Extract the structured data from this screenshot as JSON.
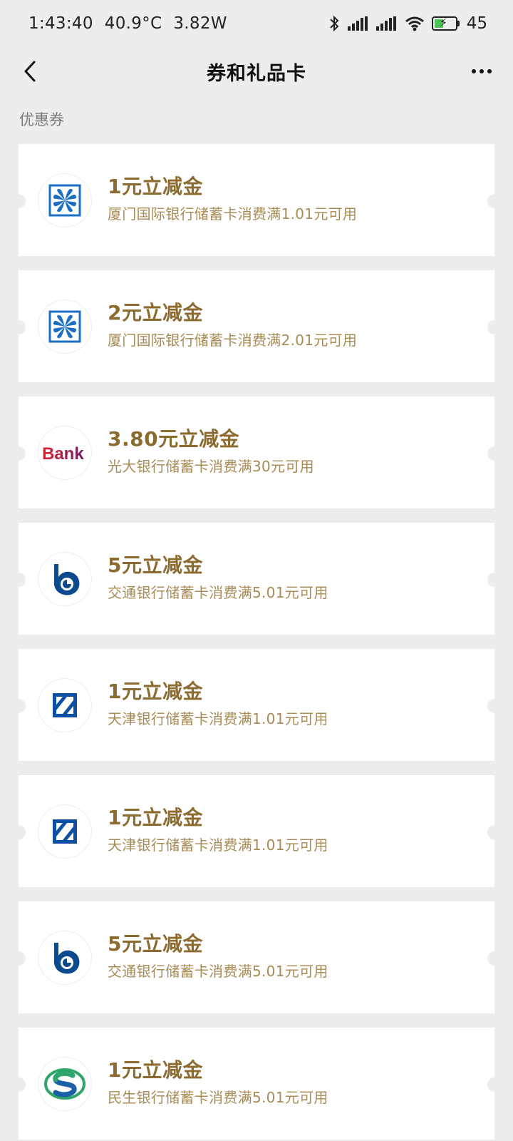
{
  "status_bar": {
    "time": "1:43:40",
    "temperature": "40.9°C",
    "power": "3.82W",
    "battery_level": "45"
  },
  "nav": {
    "title": "券和礼品卡"
  },
  "section": {
    "label": "优惠券"
  },
  "coupons": [
    {
      "title": "1元立减金",
      "desc": "厦门国际银行储蓄卡消费满1.01元可用",
      "logo": "xiamen-bank"
    },
    {
      "title": "2元立减金",
      "desc": "厦门国际银行储蓄卡消费满2.01元可用",
      "logo": "xiamen-bank"
    },
    {
      "title": "3.80元立减金",
      "desc": "光大银行储蓄卡消费满30元可用",
      "logo": "everbright-bank",
      "logo_text": "Bank"
    },
    {
      "title": "5元立减金",
      "desc": "交通银行储蓄卡消费满5.01元可用",
      "logo": "bocom"
    },
    {
      "title": "1元立减金",
      "desc": "天津银行储蓄卡消费满1.01元可用",
      "logo": "tianjin-bank"
    },
    {
      "title": "1元立减金",
      "desc": "天津银行储蓄卡消费满1.01元可用",
      "logo": "tianjin-bank"
    },
    {
      "title": "5元立减金",
      "desc": "交通银行储蓄卡消费满5.01元可用",
      "logo": "bocom"
    },
    {
      "title": "1元立减金",
      "desc": "民生银行储蓄卡消费满5.01元可用",
      "logo": "minsheng-bank"
    }
  ],
  "colors": {
    "background": "#ededed",
    "card": "#ffffff",
    "coupon_title": "#8b6b2f",
    "coupon_desc": "#a88b55",
    "xiamen_blue": "#1a6fc4",
    "everbright_red": "#e8232b",
    "everbright_purple": "#6b1d6e",
    "bocom_blue": "#0b4a8c",
    "tianjin_blue": "#0d4fa3",
    "minsheng_green": "#2ea56a",
    "minsheng_blue": "#1b5fa8"
  }
}
